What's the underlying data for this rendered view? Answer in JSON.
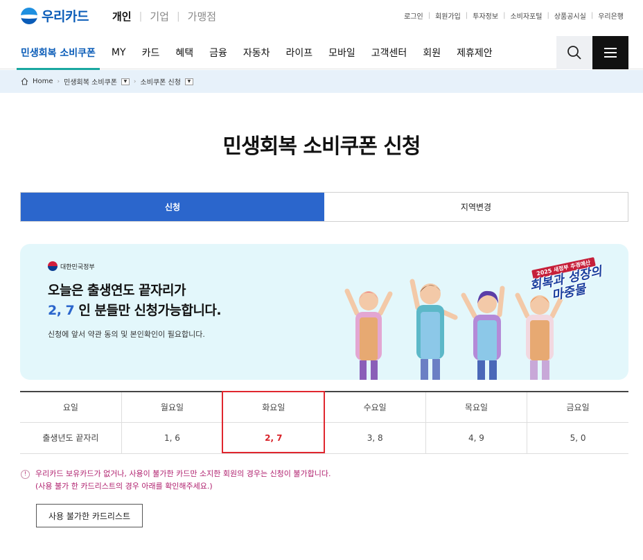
{
  "brand": {
    "name": "우리카드"
  },
  "segments": [
    "개인",
    "기업",
    "가맹점"
  ],
  "util_links": [
    "로그인",
    "회원가입",
    "투자정보",
    "소비자포털",
    "상품공시실",
    "우리은행"
  ],
  "gnb": [
    "민생회복 소비쿠폰",
    "MY",
    "카드",
    "혜택",
    "금융",
    "자동차",
    "라이프",
    "모바일",
    "고객센터",
    "회원",
    "제휴제안"
  ],
  "breadcrumb": {
    "home": "Home",
    "level1": "민생회복 소비쿠폰",
    "level2": "소비쿠폰 신청"
  },
  "page_title": "민생회복 소비쿠폰 신청",
  "tabs": [
    "신청",
    "지역변경"
  ],
  "banner": {
    "gov": "대한민국정부",
    "line1": "오늘은 출생연도 끝자리가",
    "digits": "2, 7",
    "line2_rest": " 인 분들만 신청가능합니다.",
    "note": "신청에 앞서 약관 동의 및 본인확인이 필요합니다.",
    "slogan_small": "2025 새정부 추경예산",
    "slogan_big1": "회복과 성장의",
    "slogan_big2": "마중물"
  },
  "table": {
    "header": [
      "요일",
      "월요일",
      "화요일",
      "수요일",
      "목요일",
      "금요일"
    ],
    "row": [
      "출생년도 끝자리",
      "1, 6",
      "2, 7",
      "3, 8",
      "4, 9",
      "5, 0"
    ]
  },
  "notice": {
    "icon": "!",
    "line1": "우리카드 보유카드가 없거나, 사용이 불가한 카드만 소지한 회원의 경우는 신청이 불가합니다.",
    "line2": "(사용 불가 한 카드리스트의 경우 아래를 확인해주세요.)"
  },
  "button_label": "사용 불가한 카드리스트",
  "colors": {
    "brand": "#0a5cb8",
    "tab_active": "#2b66cc",
    "highlight": "#e0262e",
    "notice": "#b0206e"
  }
}
